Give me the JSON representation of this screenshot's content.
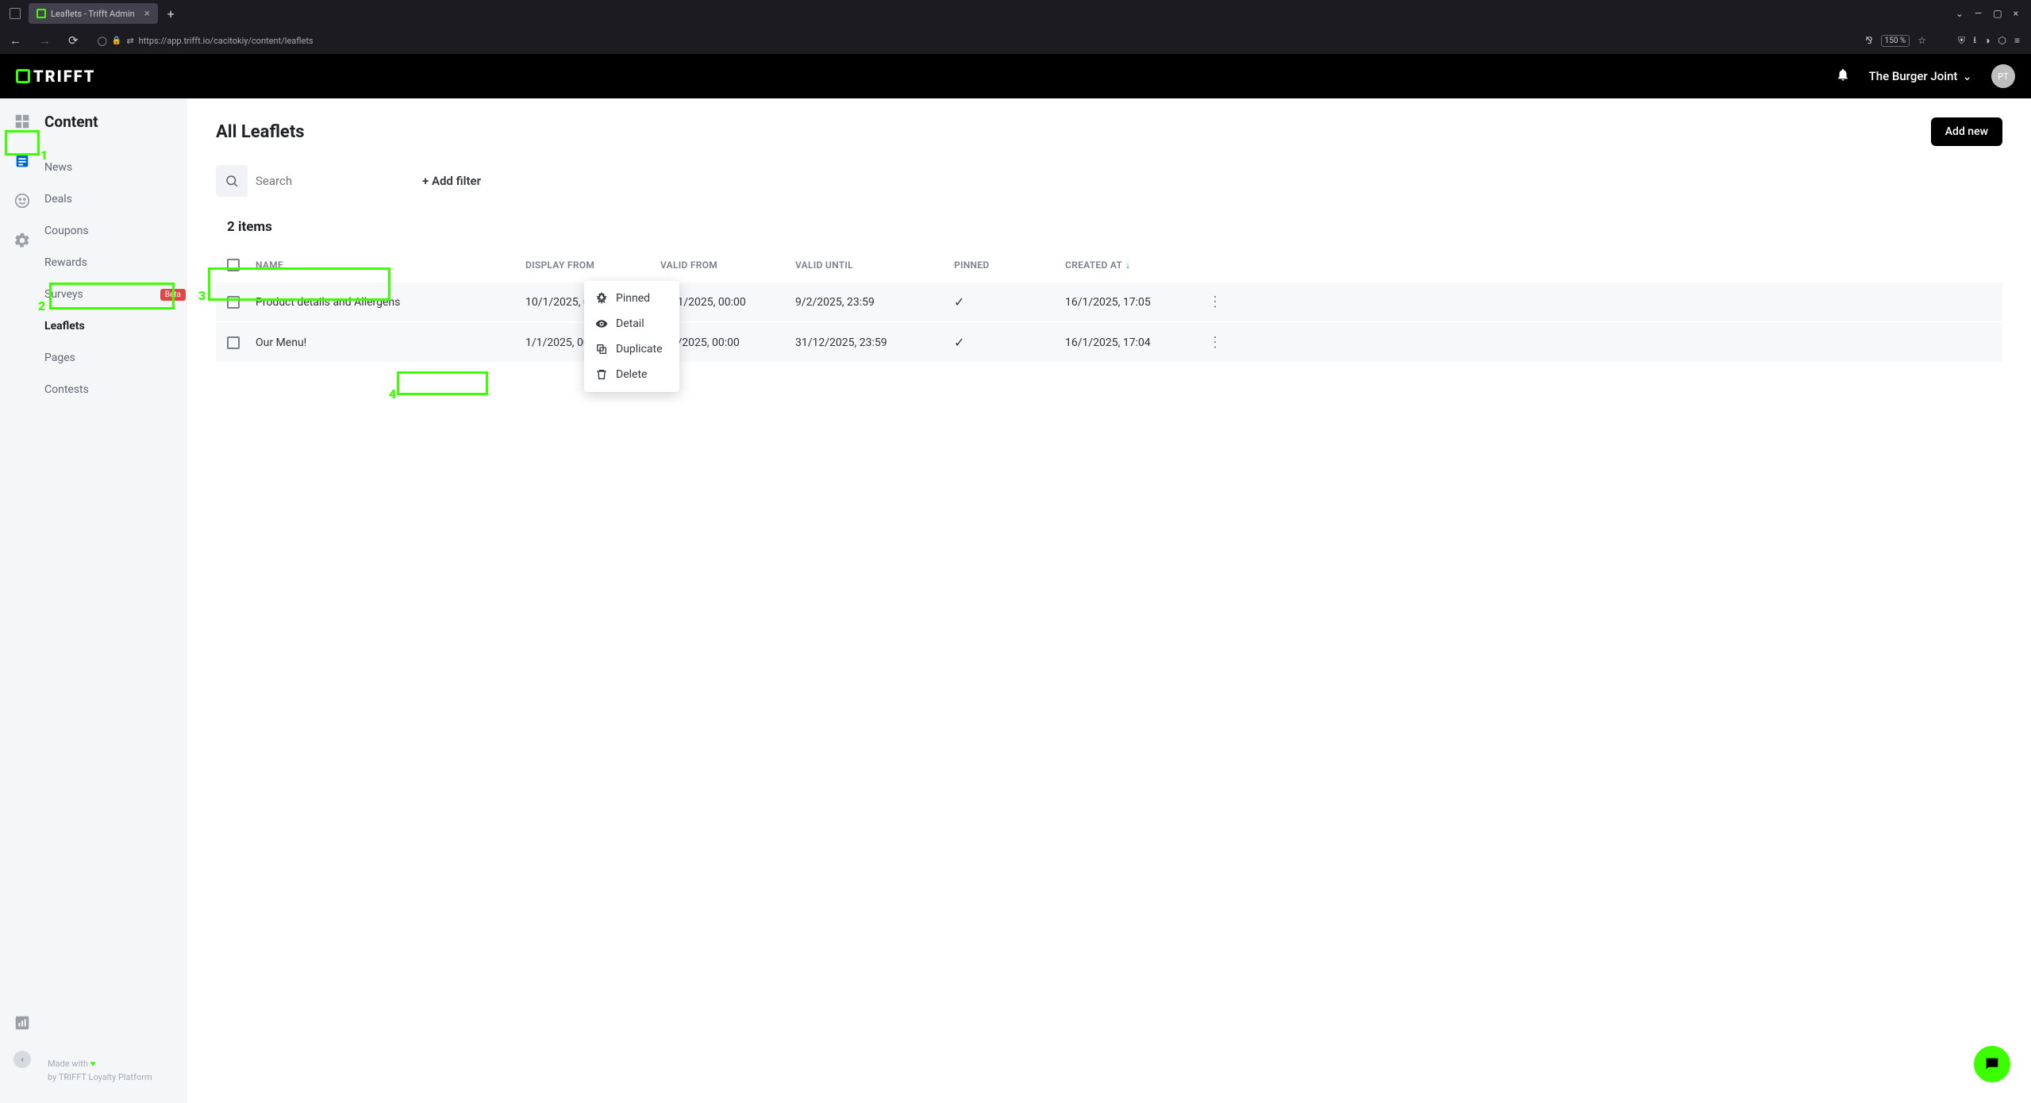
{
  "browser": {
    "tab_title": "Leaflets - Trifft Admin",
    "url": "https://app.trifft.io/cacitokiy/content/leaflets",
    "zoom": "150 %"
  },
  "header": {
    "logo_text": "TRIFFT",
    "org_name": "The Burger Joint",
    "avatar_initials": "PT"
  },
  "sidebar": {
    "section_title": "Content",
    "items": [
      {
        "label": "News",
        "active": false,
        "badge": null
      },
      {
        "label": "Deals",
        "active": false,
        "badge": null
      },
      {
        "label": "Coupons",
        "active": false,
        "badge": null
      },
      {
        "label": "Rewards",
        "active": false,
        "badge": null
      },
      {
        "label": "Surveys",
        "active": false,
        "badge": "Beta"
      },
      {
        "label": "Leaflets",
        "active": true,
        "badge": null
      },
      {
        "label": "Pages",
        "active": false,
        "badge": null
      },
      {
        "label": "Contests",
        "active": false,
        "badge": null
      }
    ]
  },
  "footer": {
    "line1": "Made with",
    "line2": "by TRIFFT Loyalty Platform"
  },
  "main": {
    "page_title": "All Leaflets",
    "add_new_label": "Add new",
    "search_placeholder": "Search",
    "add_filter_label": "+ Add filter",
    "items_count": "2 items",
    "columns": {
      "name": "NAME",
      "display_from": "DISPLAY FROM",
      "valid_from": "VALID FROM",
      "valid_until": "VALID UNTIL",
      "pinned": "PINNED",
      "created_at": "CREATED AT"
    },
    "rows": [
      {
        "name": "Product details and Allergens",
        "display_from": "10/1/2025, 00:00",
        "valid_from": "10/1/2025, 00:00",
        "valid_until": "9/2/2025, 23:59",
        "pinned": true,
        "created_at": "16/1/2025, 17:05"
      },
      {
        "name": "Our Menu!",
        "display_from": "1/1/2025, 00:00",
        "valid_from": "1/1/2025, 00:00",
        "valid_until": "31/12/2025, 23:59",
        "pinned": true,
        "created_at": "16/1/2025, 17:04"
      }
    ]
  },
  "context_menu": {
    "items": [
      {
        "label": "Pinned",
        "icon": "pin"
      },
      {
        "label": "Detail",
        "icon": "eye"
      },
      {
        "label": "Duplicate",
        "icon": "copy"
      },
      {
        "label": "Delete",
        "icon": "trash"
      }
    ]
  },
  "annotations": {
    "n1": "1",
    "n2": "2",
    "n3": "3",
    "n4": "4"
  }
}
